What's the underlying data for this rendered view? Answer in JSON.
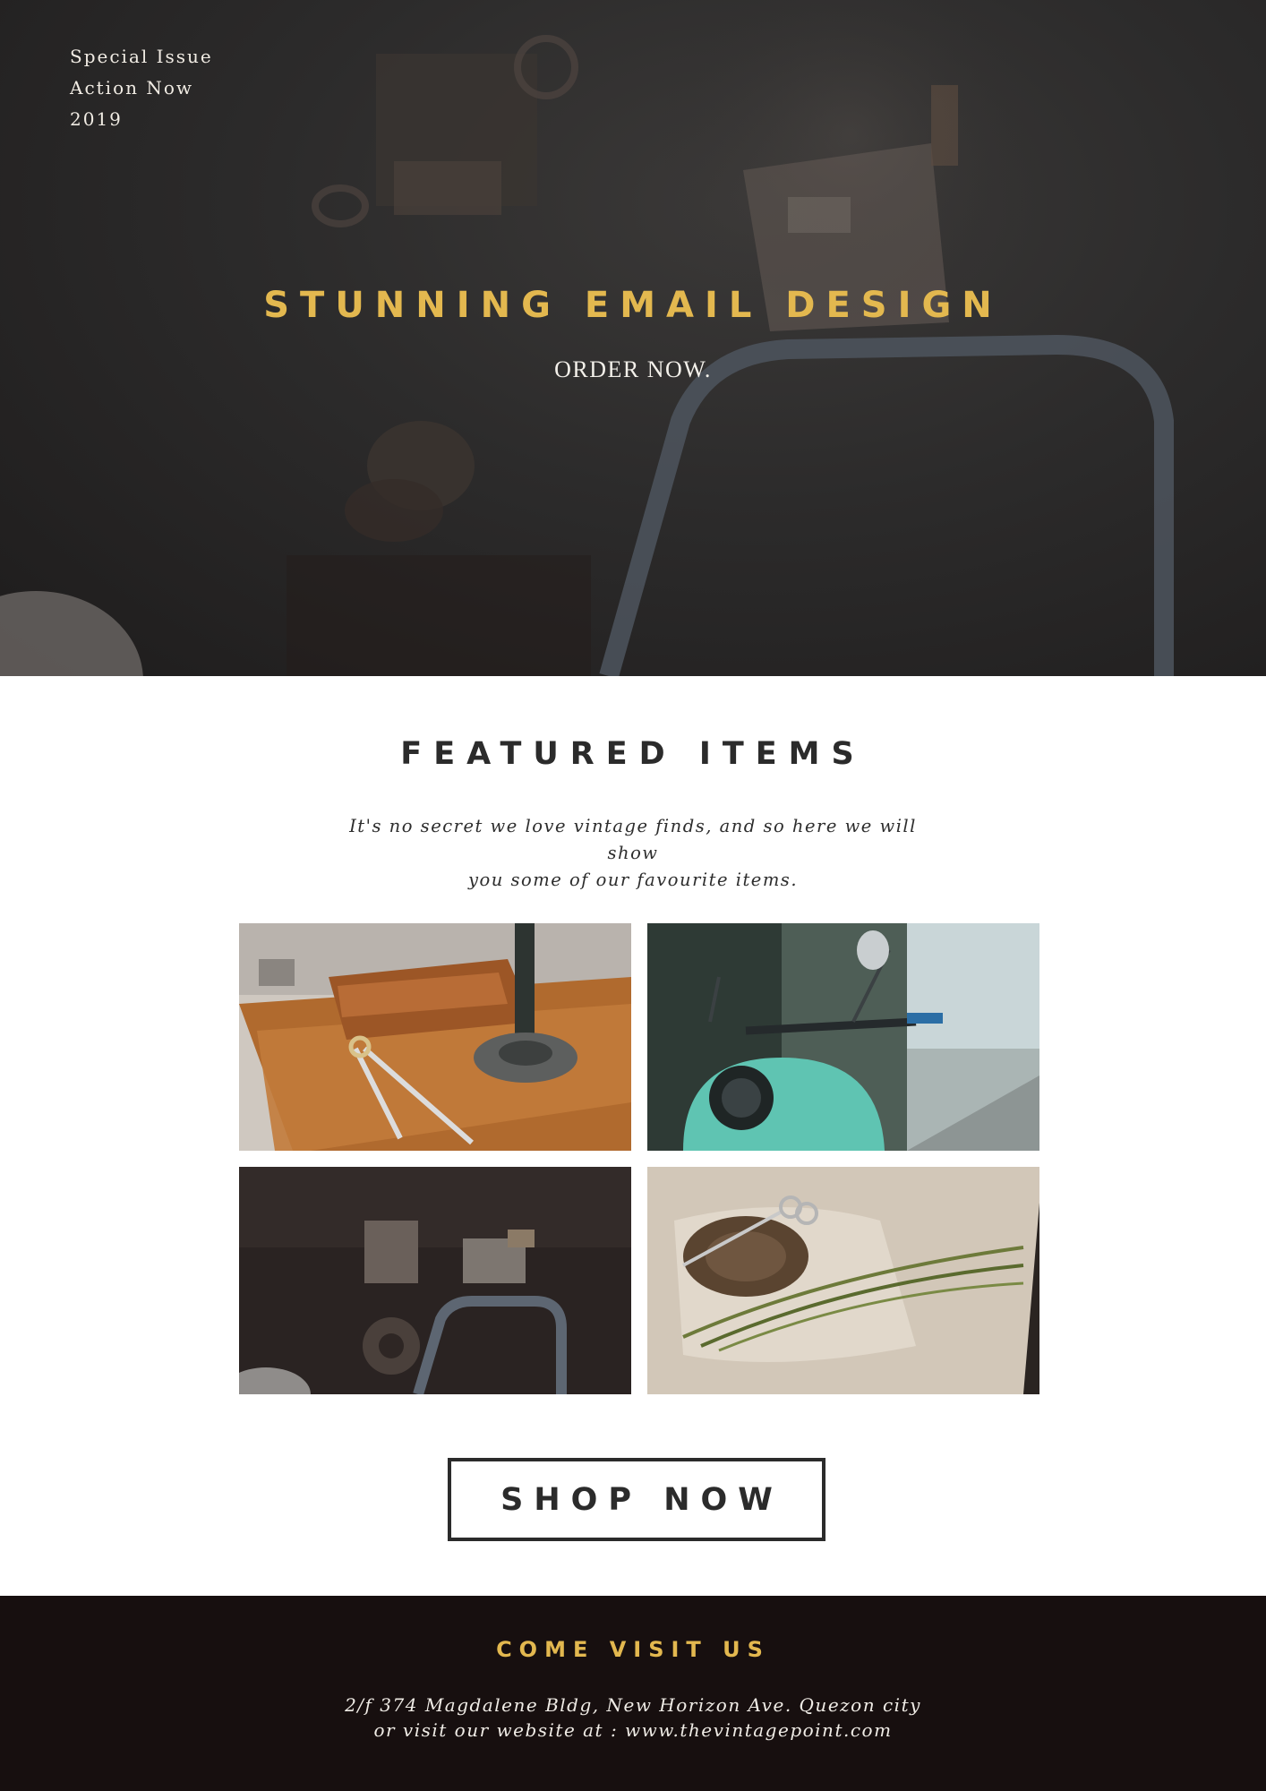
{
  "header": {
    "issue_lines": [
      "Special Issue",
      "Action Now",
      "2019"
    ],
    "title": "STUNNING EMAIL DESIGN",
    "subtitle": "ORDER NOW."
  },
  "featured": {
    "title": "FEATURED ITEMS",
    "intro_line1": "It's no secret we love vintage finds, and so here we will show",
    "intro_line2": "you some of our favourite items.",
    "items": [
      {
        "image": "compass-on-wooden-desk"
      },
      {
        "image": "mint-scooter"
      },
      {
        "image": "vintage-machines"
      },
      {
        "image": "scissors-and-twine"
      }
    ]
  },
  "cta": {
    "shop_label": "SHOP NOW"
  },
  "footer": {
    "title": "COME VISIT US",
    "address_line1": "2/f 374 Magdalene Bldg, New Horizon Ave. Quezon city",
    "address_line2": "or visit our website at : www.thevintagepoint.com"
  },
  "colors": {
    "accent": "#e3b84f",
    "dark": "#2b2b2b",
    "footer_bg": "#170f0f"
  }
}
